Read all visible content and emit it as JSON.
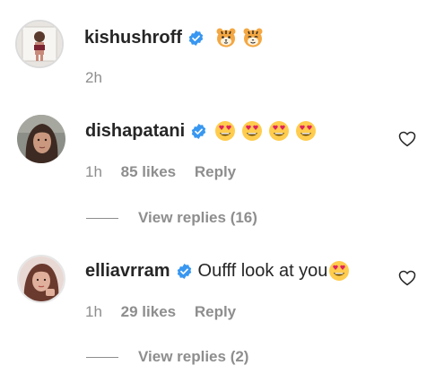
{
  "comments": [
    {
      "username": "kishushroff",
      "verified": true,
      "text": "",
      "emojis": [
        "tiger-face-emoji",
        "tiger-face-emoji"
      ],
      "time": "2h",
      "likes": "",
      "reply_label": "",
      "avatar_icon": "profile-photo"
    },
    {
      "username": "dishapatani",
      "verified": true,
      "text": "",
      "emojis": [
        "heart-eyes-emoji",
        "heart-eyes-emoji",
        "heart-eyes-emoji",
        "heart-eyes-emoji"
      ],
      "time": "1h",
      "likes": "85 likes",
      "reply_label": "Reply",
      "view_replies": "View replies (16)",
      "avatar_icon": "profile-photo"
    },
    {
      "username": "elliavrram",
      "verified": true,
      "text": "Oufff look at you",
      "emojis": [
        "heart-eyes-emoji"
      ],
      "time": "1h",
      "likes": "29 likes",
      "reply_label": "Reply",
      "view_replies": "View replies (2)",
      "avatar_icon": "profile-photo"
    }
  ],
  "colors": {
    "text": "#262626",
    "secondary": "#8e8e8e",
    "verified_blue": "#3897f0",
    "emoji_yellow": "#ffcc4d",
    "emoji_heart": "#e0245e"
  }
}
